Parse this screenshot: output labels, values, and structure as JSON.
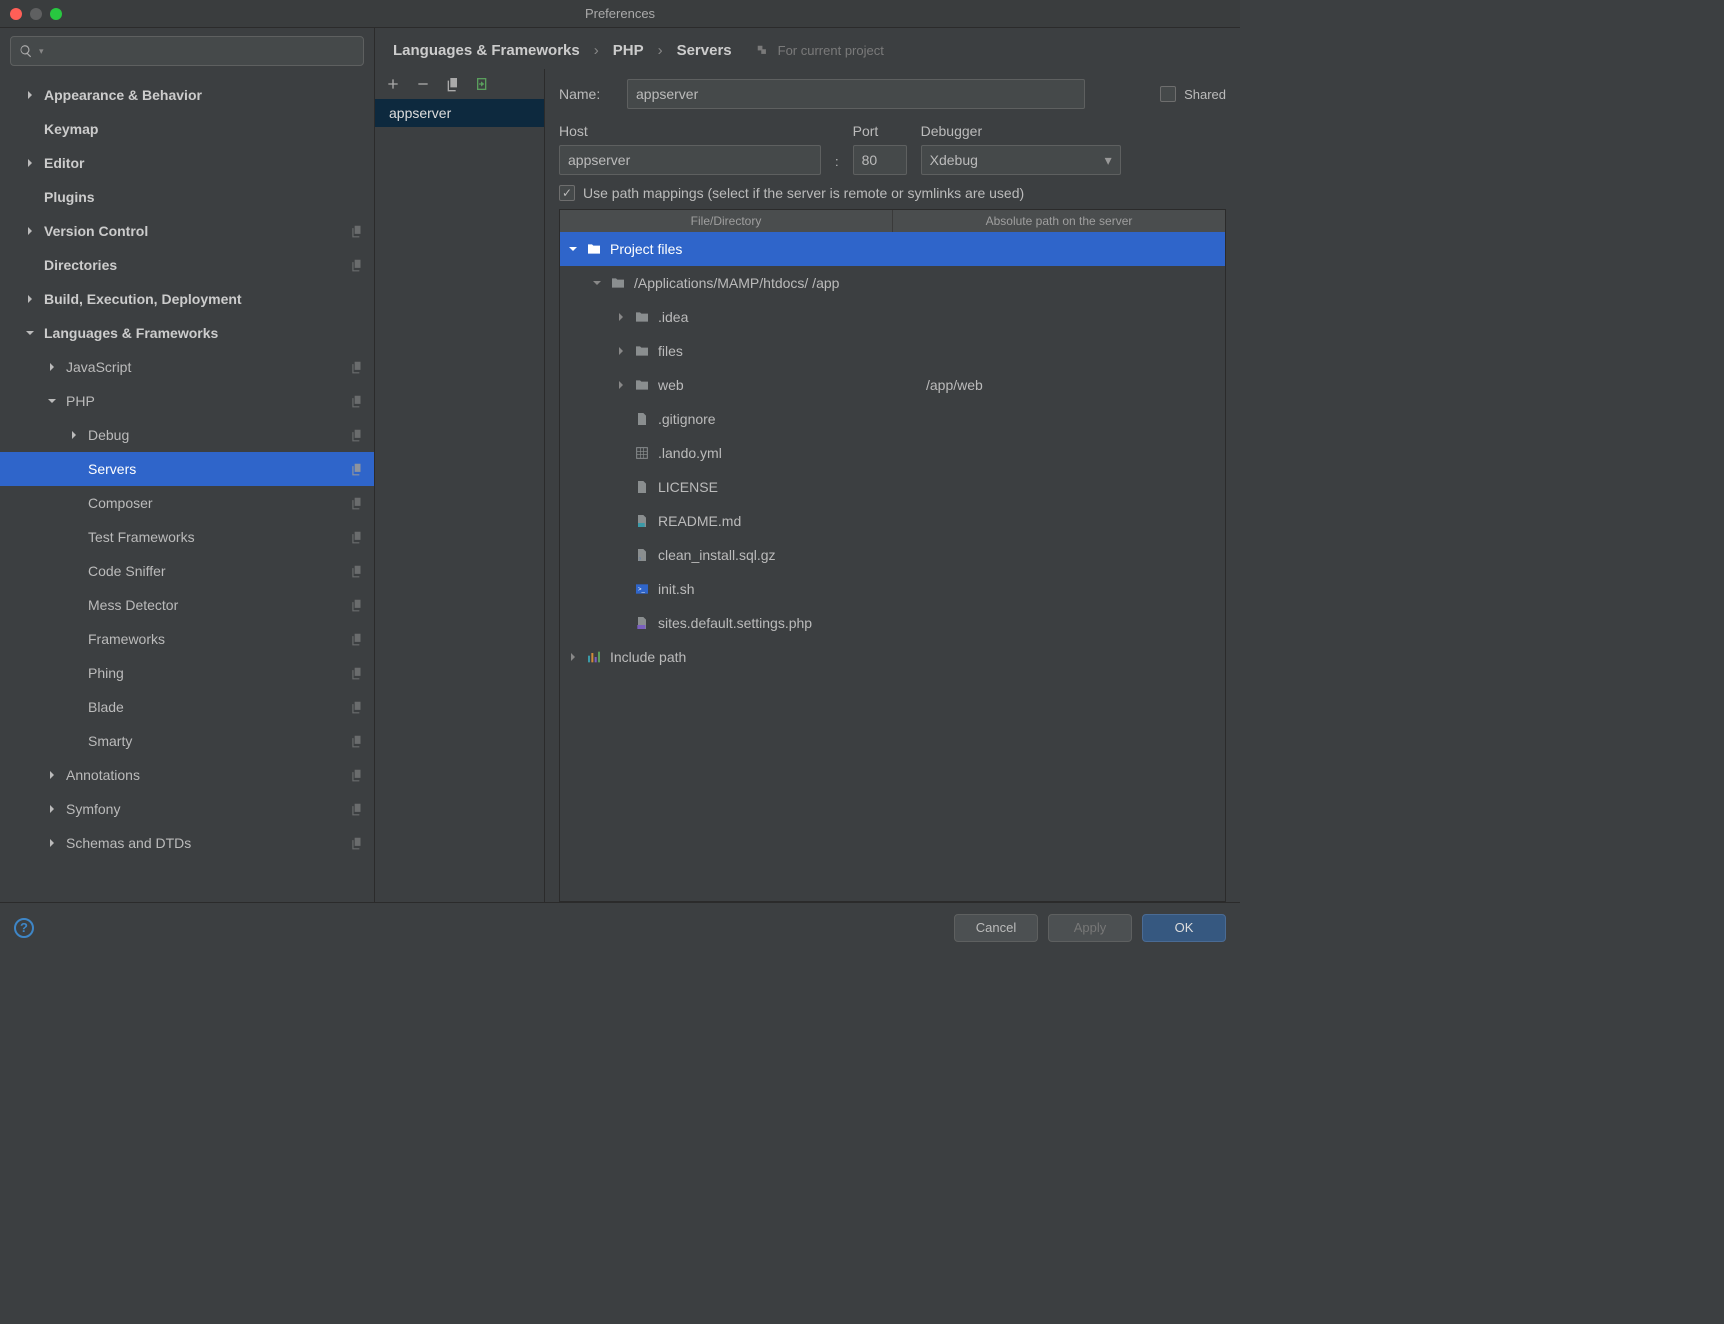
{
  "window_title": "Preferences",
  "sidebar": {
    "items": [
      {
        "label": "Appearance & Behavior",
        "bold": true,
        "arrow": "right",
        "indent": 0
      },
      {
        "label": "Keymap",
        "bold": true,
        "indent": 0
      },
      {
        "label": "Editor",
        "bold": true,
        "arrow": "right",
        "indent": 0
      },
      {
        "label": "Plugins",
        "bold": true,
        "indent": 0
      },
      {
        "label": "Version Control",
        "bold": true,
        "arrow": "right",
        "indent": 0,
        "copy": true
      },
      {
        "label": "Directories",
        "bold": true,
        "indent": 0,
        "copy": true
      },
      {
        "label": "Build, Execution, Deployment",
        "bold": true,
        "arrow": "right",
        "indent": 0
      },
      {
        "label": "Languages & Frameworks",
        "bold": true,
        "arrow": "down",
        "indent": 0
      },
      {
        "label": "JavaScript",
        "arrow": "right",
        "indent": 1,
        "copy": true
      },
      {
        "label": "PHP",
        "arrow": "down",
        "indent": 1,
        "copy": true
      },
      {
        "label": "Debug",
        "arrow": "right",
        "indent": 2,
        "copy": true
      },
      {
        "label": "Servers",
        "indent": 2,
        "copy": true,
        "selected": true
      },
      {
        "label": "Composer",
        "indent": 2,
        "copy": true
      },
      {
        "label": "Test Frameworks",
        "indent": 2,
        "copy": true
      },
      {
        "label": "Code Sniffer",
        "indent": 2,
        "copy": true
      },
      {
        "label": "Mess Detector",
        "indent": 2,
        "copy": true
      },
      {
        "label": "Frameworks",
        "indent": 2,
        "copy": true
      },
      {
        "label": "Phing",
        "indent": 2,
        "copy": true
      },
      {
        "label": "Blade",
        "indent": 2,
        "copy": true
      },
      {
        "label": "Smarty",
        "indent": 2,
        "copy": true
      },
      {
        "label": "Annotations",
        "arrow": "right",
        "indent": 1,
        "copy": true
      },
      {
        "label": "Symfony",
        "arrow": "right",
        "indent": 1,
        "copy": true
      },
      {
        "label": "Schemas and DTDs",
        "arrow": "right",
        "indent": 1,
        "copy": true
      }
    ]
  },
  "breadcrumb": {
    "parts": [
      "Languages & Frameworks",
      "PHP",
      "Servers"
    ],
    "note": "For current project"
  },
  "server_list": {
    "items": [
      "appserver"
    ]
  },
  "form": {
    "name_label": "Name:",
    "name_value": "appserver",
    "shared_label": "Shared",
    "host_label": "Host",
    "host_value": "appserver",
    "port_label": "Port",
    "port_value": "80",
    "debugger_label": "Debugger",
    "debugger_value": "Xdebug",
    "path_checkbox_label": "Use path mappings (select if the server is remote or symlinks are used)",
    "path_col1": "File/Directory",
    "path_col2": "Absolute path on the server"
  },
  "paths": [
    {
      "label": "Project files",
      "exp": "down",
      "icon": "folder",
      "indent": 0,
      "sel": true
    },
    {
      "label": "/Applications/MAMP/htdocs/ /app",
      "exp": "down",
      "icon": "folder",
      "indent": 1
    },
    {
      "label": ".idea",
      "exp": "right",
      "icon": "folder",
      "indent": 2
    },
    {
      "label": "files",
      "exp": "right",
      "icon": "folder",
      "indent": 2
    },
    {
      "label": "web",
      "exp": "right",
      "icon": "folder",
      "indent": 2,
      "map": "/app/web"
    },
    {
      "label": ".gitignore",
      "icon": "file",
      "indent": 2
    },
    {
      "label": ".lando.yml",
      "icon": "grid",
      "indent": 2
    },
    {
      "label": "LICENSE",
      "icon": "file",
      "indent": 2
    },
    {
      "label": "README.md",
      "icon": "md",
      "indent": 2
    },
    {
      "label": "clean_install.sql.gz",
      "icon": "sql",
      "indent": 2
    },
    {
      "label": "init.sh",
      "icon": "sh",
      "indent": 2
    },
    {
      "label": "sites.default.settings.php",
      "icon": "php",
      "indent": 2
    },
    {
      "label": "Include path",
      "exp": "right",
      "icon": "bars",
      "indent": 0
    }
  ],
  "footer": {
    "cancel": "Cancel",
    "apply": "Apply",
    "ok": "OK"
  }
}
